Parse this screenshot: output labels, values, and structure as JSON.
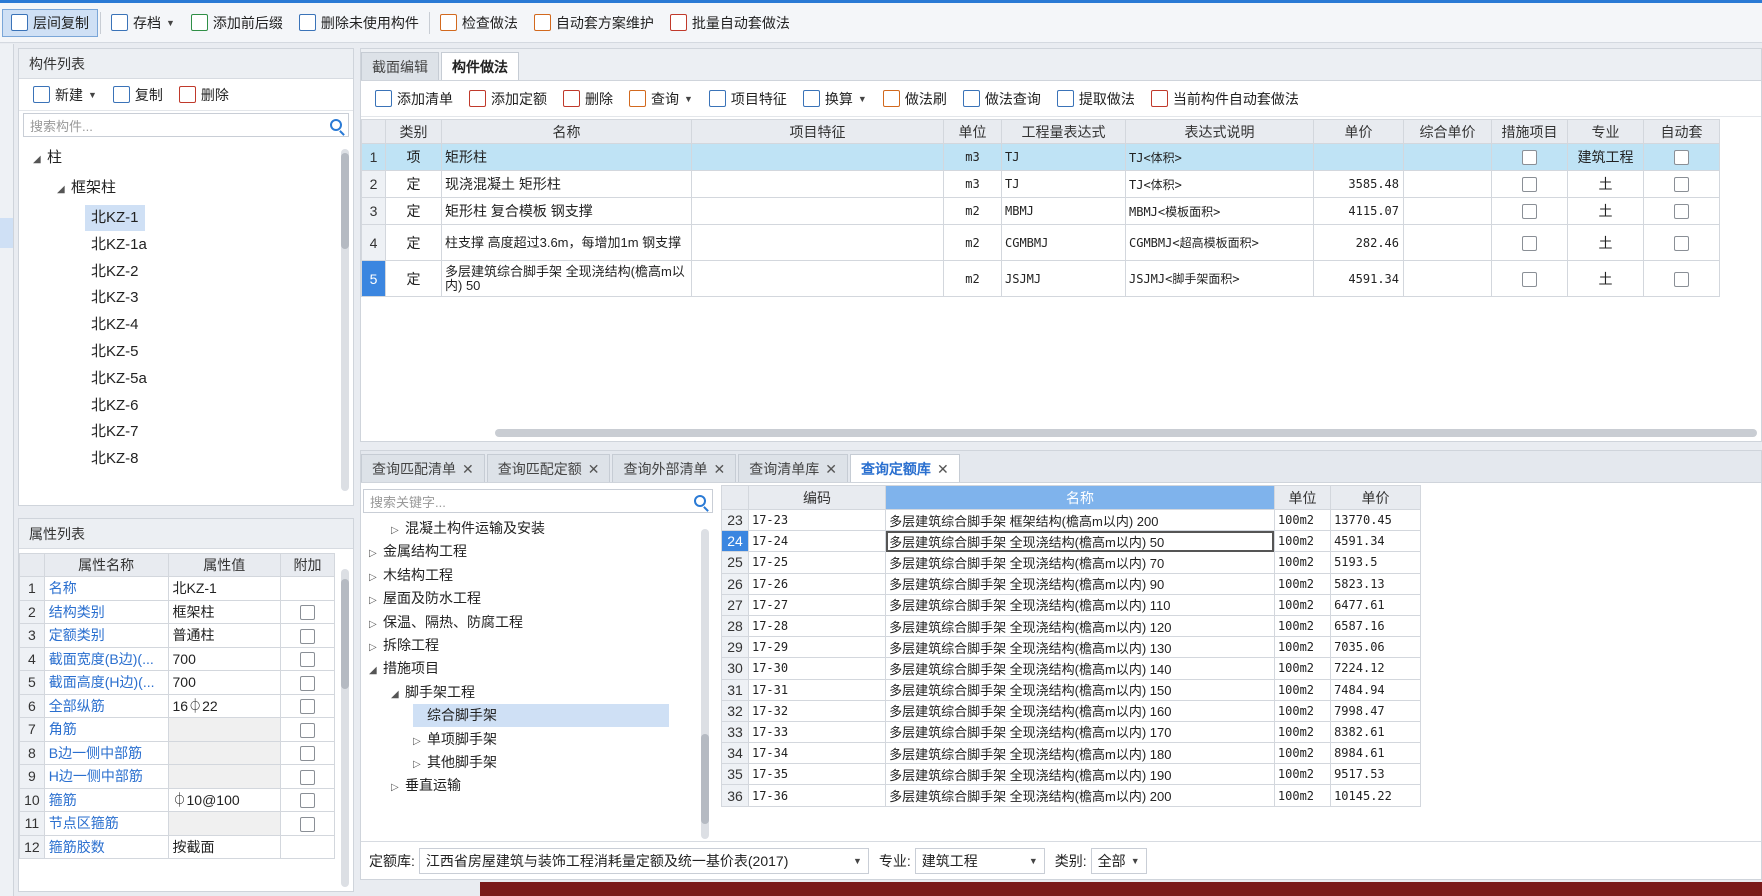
{
  "toolbar": {
    "items": [
      {
        "label": "层间复制",
        "icon": "copy-layers-icon",
        "active": true
      },
      {
        "label": "存档",
        "icon": "save-icon",
        "dropdown": true
      },
      {
        "label": "添加前后缀",
        "icon": "prefix-icon"
      },
      {
        "label": "删除未使用构件",
        "icon": "delete-unused-icon"
      },
      {
        "label": "检查做法",
        "icon": "check-icon"
      },
      {
        "label": "自动套方案维护",
        "icon": "maintain-icon"
      },
      {
        "label": "批量自动套做法",
        "icon": "batch-icon"
      }
    ]
  },
  "component_panel": {
    "title": "构件列表",
    "new_label": "新建",
    "copy_label": "复制",
    "delete_label": "删除",
    "search_placeholder": "搜索构件...",
    "tree_root": "柱",
    "tree_group": "框架柱",
    "items": [
      "北KZ-1",
      "北KZ-1a",
      "北KZ-2",
      "北KZ-3",
      "北KZ-4",
      "北KZ-5",
      "北KZ-5a",
      "北KZ-6",
      "北KZ-7",
      "北KZ-8"
    ],
    "selected": "北KZ-1"
  },
  "property_panel": {
    "title": "属性列表",
    "headers": [
      "属性名称",
      "属性值",
      "附加"
    ],
    "rows": [
      {
        "n": "1",
        "name": "名称",
        "value": "北KZ-1",
        "check": false
      },
      {
        "n": "2",
        "name": "结构类别",
        "value": "框架柱",
        "check": true
      },
      {
        "n": "3",
        "name": "定额类别",
        "value": "普通柱",
        "check": true
      },
      {
        "n": "4",
        "name": "截面宽度(B边)(...",
        "value": "700",
        "check": true
      },
      {
        "n": "5",
        "name": "截面高度(H边)(...",
        "value": "700",
        "check": true
      },
      {
        "n": "6",
        "name": "全部纵筋",
        "value": "16⏀22",
        "check": true
      },
      {
        "n": "7",
        "name": "角筋",
        "value": "",
        "check": true
      },
      {
        "n": "8",
        "name": "B边一侧中部筋",
        "value": "",
        "check": true
      },
      {
        "n": "9",
        "name": "H边一侧中部筋",
        "value": "",
        "check": true
      },
      {
        "n": "10",
        "name": "箍筋",
        "value": "⏀10@100",
        "check": true
      },
      {
        "n": "11",
        "name": "节点区箍筋",
        "value": "",
        "check": true
      },
      {
        "n": "12",
        "name": "箍筋胶数",
        "value": "按截面",
        "check": false
      }
    ]
  },
  "method_panel": {
    "tabs": [
      "截面编辑",
      "构件做法"
    ],
    "active_tab": "构件做法",
    "toolbar": [
      "添加清单",
      "添加定额",
      "删除",
      "查询",
      "项目特征",
      "换算",
      "做法刷",
      "做法查询",
      "提取做法",
      "当前构件自动套做法"
    ],
    "headers": [
      "类别",
      "名称",
      "项目特征",
      "单位",
      "工程量表达式",
      "表达式说明",
      "单价",
      "综合单价",
      "措施项目",
      "专业",
      "自动套"
    ],
    "rows": [
      {
        "n": "1",
        "type": "项",
        "name": "矩形柱",
        "feature": "",
        "unit": "m3",
        "expr": "TJ",
        "desc": "TJ<体积>",
        "price": "",
        "major": "建筑工程"
      },
      {
        "n": "2",
        "type": "定",
        "name": "现浇混凝土 矩形柱",
        "feature": "",
        "unit": "m3",
        "expr": "TJ",
        "desc": "TJ<体积>",
        "price": "3585.48",
        "major": "土"
      },
      {
        "n": "3",
        "type": "定",
        "name": "矩形柱 复合模板 钢支撑",
        "feature": "",
        "unit": "m2",
        "expr": "MBMJ",
        "desc": "MBMJ<模板面积>",
        "price": "4115.07",
        "major": "土"
      },
      {
        "n": "4",
        "type": "定",
        "name": "柱支撑 高度超过3.6m，每增加1m 钢支撑",
        "feature": "",
        "unit": "m2",
        "expr": "CGMBMJ",
        "desc": "CGMBMJ<超高模板面积>",
        "price": "282.46",
        "major": "土"
      },
      {
        "n": "5",
        "type": "定",
        "name": "多层建筑综合脚手架 全现浇结构(檐高m以内) 50",
        "feature": "",
        "unit": "m2",
        "expr": "JSJMJ",
        "desc": "JSJMJ<脚手架面积>",
        "price": "4591.34",
        "major": "土"
      }
    ]
  },
  "query_panel": {
    "tabs": [
      "查询匹配清单",
      "查询匹配定额",
      "查询外部清单",
      "查询清单库",
      "查询定额库"
    ],
    "active_tab": "查询定额库",
    "search_placeholder": "搜索关键字...",
    "tree": [
      {
        "label": "混凝土构件运输及安装",
        "indent": 2,
        "tri": "▷"
      },
      {
        "label": "金属结构工程",
        "indent": 1,
        "tri": "▷"
      },
      {
        "label": "木结构工程",
        "indent": 1,
        "tri": "▷"
      },
      {
        "label": "屋面及防水工程",
        "indent": 1,
        "tri": "▷"
      },
      {
        "label": "保温、隔热、防腐工程",
        "indent": 1,
        "tri": "▷"
      },
      {
        "label": "拆除工程",
        "indent": 1,
        "tri": "▷"
      },
      {
        "label": "措施项目",
        "indent": 1,
        "tri": "◢"
      },
      {
        "label": "脚手架工程",
        "indent": 2,
        "tri": "◢"
      },
      {
        "label": "综合脚手架",
        "indent": 3,
        "tri": "",
        "selected": true
      },
      {
        "label": "单项脚手架",
        "indent": 3,
        "tri": "▷"
      },
      {
        "label": "其他脚手架",
        "indent": 3,
        "tri": "▷"
      },
      {
        "label": "垂直运输",
        "indent": 2,
        "tri": "▷"
      }
    ],
    "headers": [
      "编码",
      "名称",
      "单位",
      "单价"
    ],
    "rows": [
      {
        "n": "23",
        "code": "17-23",
        "name": "多层建筑综合脚手架 框架结构(檐高m以内) 200",
        "unit": "100m2",
        "price": "13770.45"
      },
      {
        "n": "24",
        "code": "17-24",
        "name": "多层建筑综合脚手架 全现浇结构(檐高m以内) 50",
        "unit": "100m2",
        "price": "4591.34"
      },
      {
        "n": "25",
        "code": "17-25",
        "name": "多层建筑综合脚手架 全现浇结构(檐高m以内) 70",
        "unit": "100m2",
        "price": "5193.5"
      },
      {
        "n": "26",
        "code": "17-26",
        "name": "多层建筑综合脚手架 全现浇结构(檐高m以内) 90",
        "unit": "100m2",
        "price": "5823.13"
      },
      {
        "n": "27",
        "code": "17-27",
        "name": "多层建筑综合脚手架 全现浇结构(檐高m以内) 110",
        "unit": "100m2",
        "price": "6477.61"
      },
      {
        "n": "28",
        "code": "17-28",
        "name": "多层建筑综合脚手架 全现浇结构(檐高m以内) 120",
        "unit": "100m2",
        "price": "6587.16"
      },
      {
        "n": "29",
        "code": "17-29",
        "name": "多层建筑综合脚手架 全现浇结构(檐高m以内) 130",
        "unit": "100m2",
        "price": "7035.06"
      },
      {
        "n": "30",
        "code": "17-30",
        "name": "多层建筑综合脚手架 全现浇结构(檐高m以内) 140",
        "unit": "100m2",
        "price": "7224.12"
      },
      {
        "n": "31",
        "code": "17-31",
        "name": "多层建筑综合脚手架 全现浇结构(檐高m以内) 150",
        "unit": "100m2",
        "price": "7484.94"
      },
      {
        "n": "32",
        "code": "17-32",
        "name": "多层建筑综合脚手架 全现浇结构(檐高m以内) 160",
        "unit": "100m2",
        "price": "7998.47"
      },
      {
        "n": "33",
        "code": "17-33",
        "name": "多层建筑综合脚手架 全现浇结构(檐高m以内) 170",
        "unit": "100m2",
        "price": "8382.61"
      },
      {
        "n": "34",
        "code": "17-34",
        "name": "多层建筑综合脚手架 全现浇结构(檐高m以内) 180",
        "unit": "100m2",
        "price": "8984.61"
      },
      {
        "n": "35",
        "code": "17-35",
        "name": "多层建筑综合脚手架 全现浇结构(檐高m以内) 190",
        "unit": "100m2",
        "price": "9517.53"
      },
      {
        "n": "36",
        "code": "17-36",
        "name": "多层建筑综合脚手架 全现浇结构(檐高m以内) 200",
        "unit": "100m2",
        "price": "10145.22"
      }
    ],
    "selected_row": "24",
    "footer": {
      "lib_label": "定额库:",
      "lib_value": "江西省房屋建筑与装饰工程消耗量定额及统一基价表(2017)",
      "major_label": "专业:",
      "major_value": "建筑工程",
      "type_label": "类别:",
      "type_value": "全部"
    }
  },
  "colors": {
    "accent": "#2a7ad5",
    "selected_row": "#bfe3f5",
    "link": "#2a6fcf"
  }
}
